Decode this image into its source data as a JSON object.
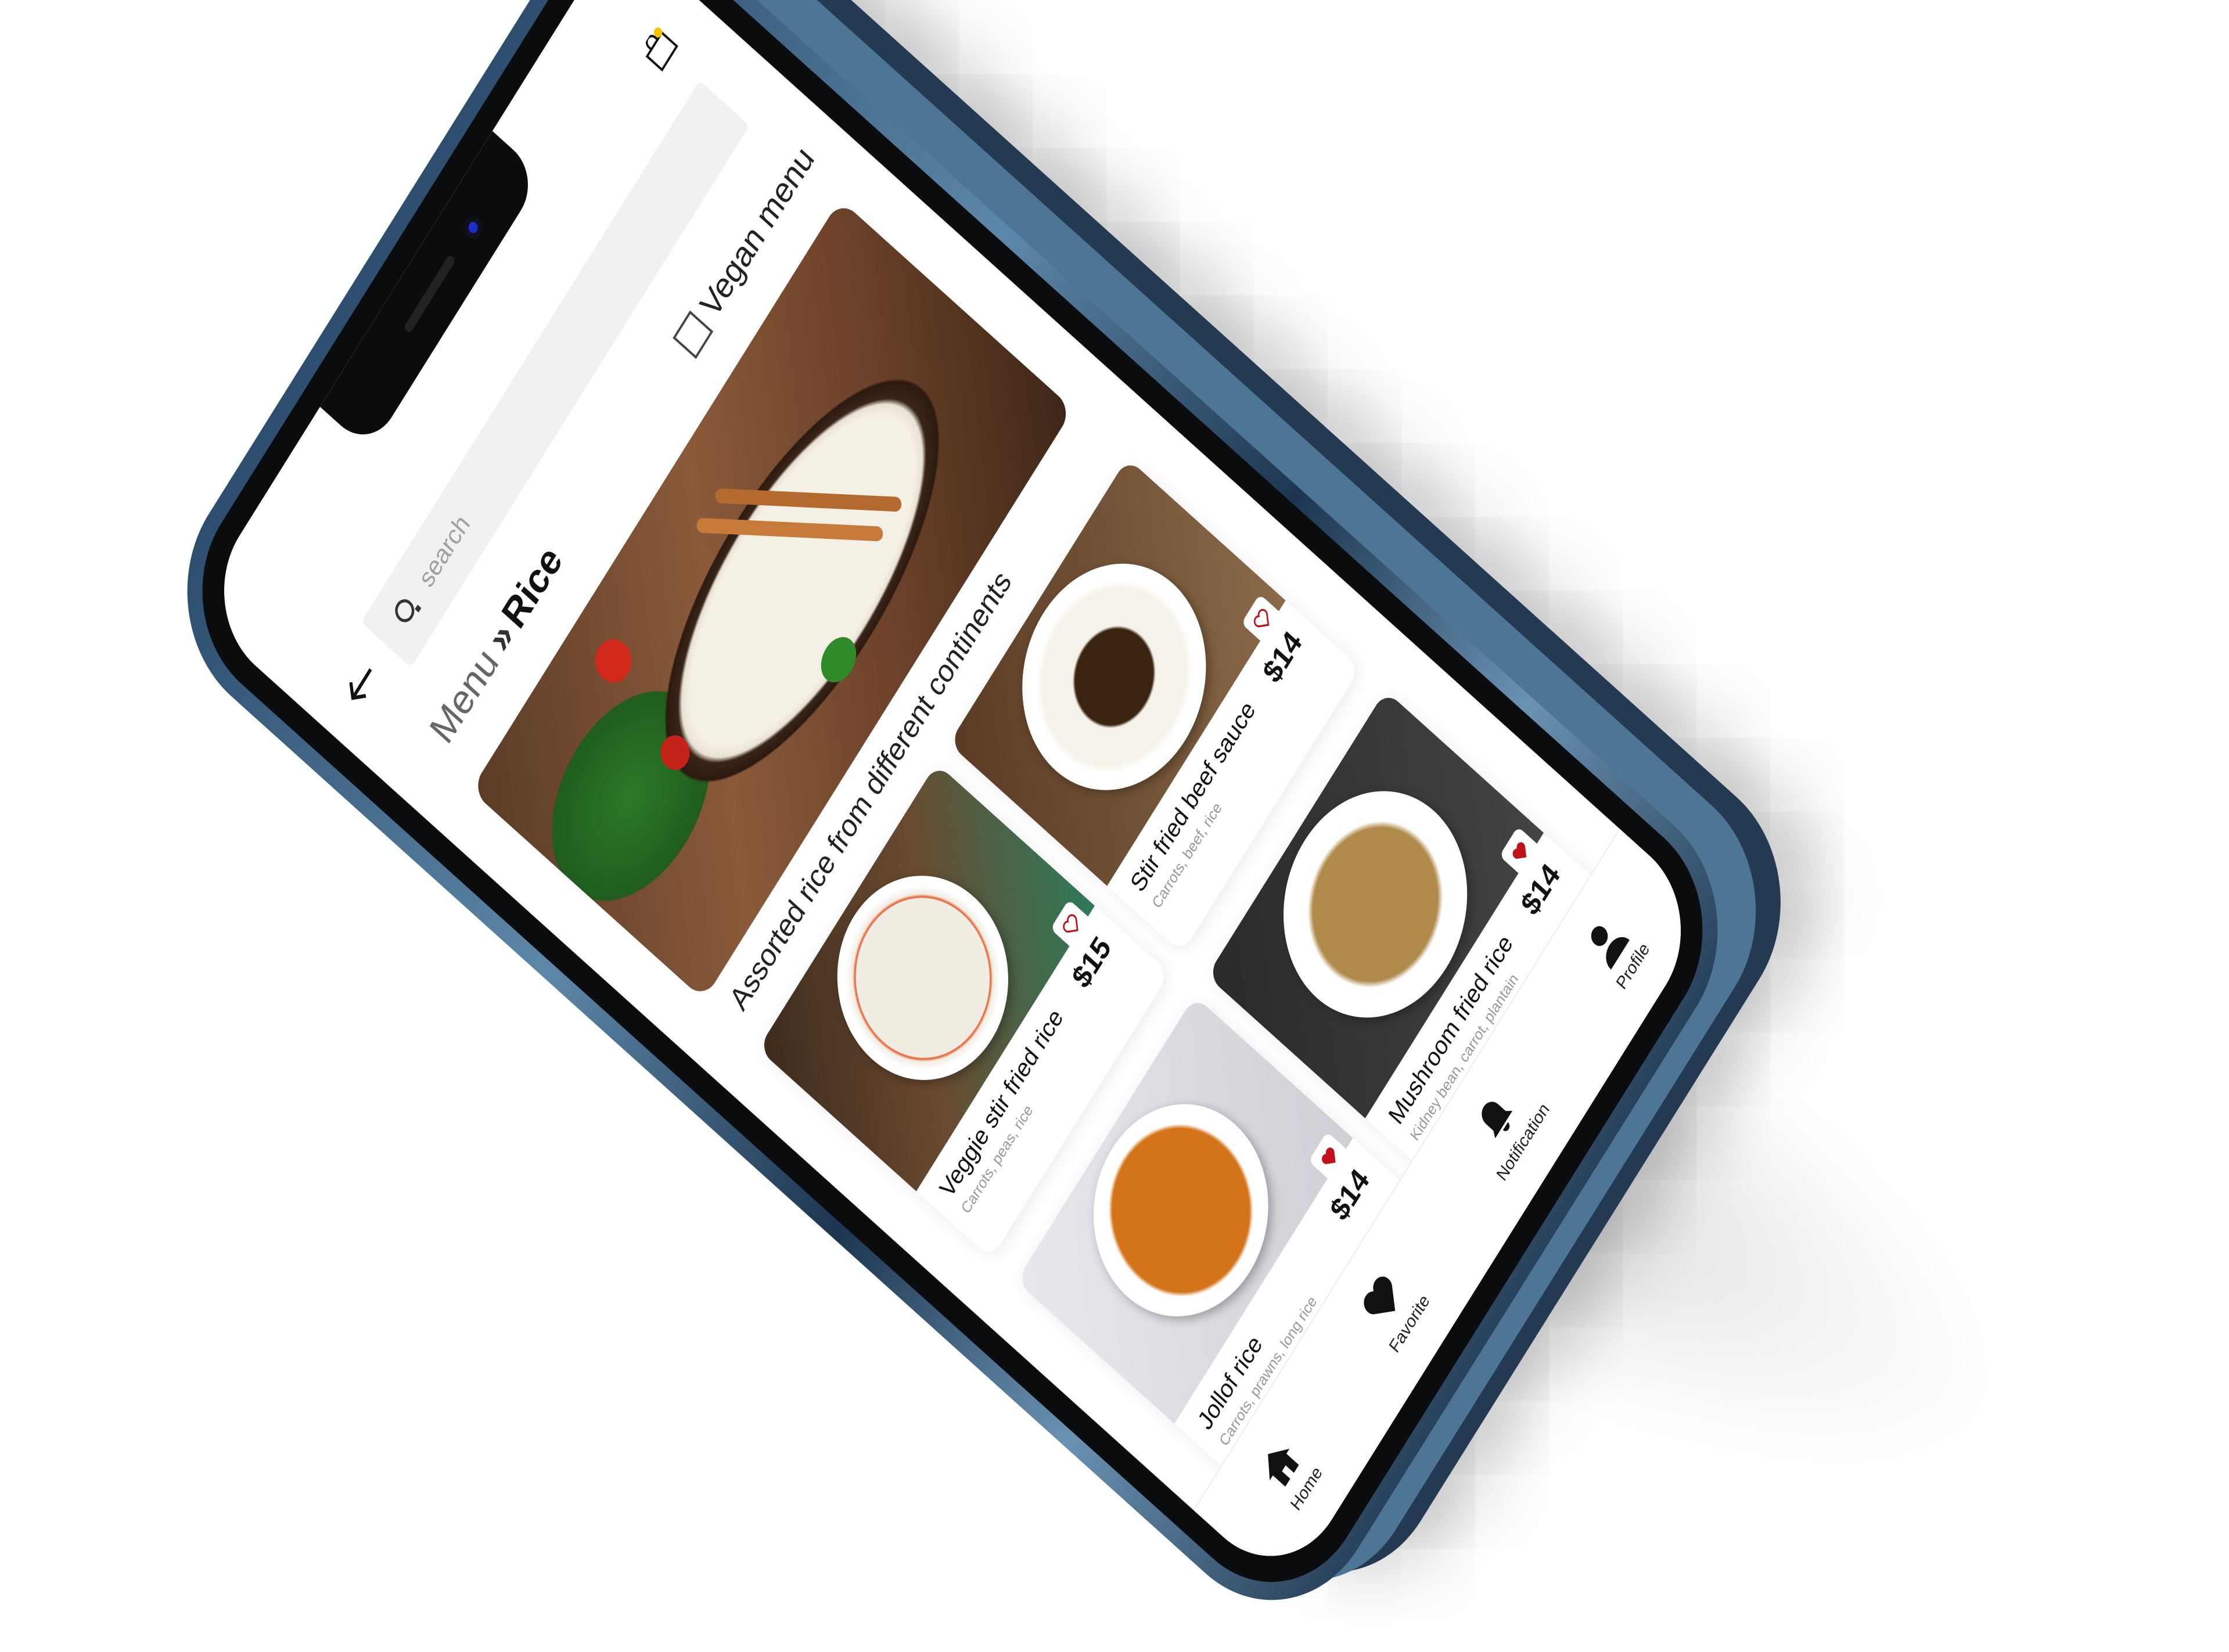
{
  "search": {
    "placeholder": "search"
  },
  "breadcrumb": {
    "parent": "Menu",
    "separator": "»",
    "current": "Rice"
  },
  "filter": {
    "vegan_label": "Vegan menu",
    "vegan_checked": false
  },
  "hero": {
    "caption": "Assorted rice from different continents"
  },
  "items": [
    {
      "name": "Veggie stir fried rice",
      "desc": "Carrots, peas, rice",
      "price": "$15",
      "favorited": false
    },
    {
      "name": "Stir fried beef sauce",
      "desc": "Carrots, beef, rice",
      "price": "$14",
      "favorited": false
    },
    {
      "name": "Jollof rice",
      "desc": "Carrots, prawns, long rice",
      "price": "$14",
      "favorited": true
    },
    {
      "name": "Mushroom fried rice",
      "desc": "Kidney bean, carrot, plantain",
      "price": "$14",
      "favorited": true
    }
  ],
  "nav": [
    {
      "label": "Home",
      "icon": "home-icon"
    },
    {
      "label": "Favorite",
      "icon": "heart-icon"
    },
    {
      "label": "Notification",
      "icon": "bell-icon"
    },
    {
      "label": "Profile",
      "icon": "user-icon"
    }
  ],
  "colors": {
    "accent": "#f5c400",
    "heart_active": "#c0101a",
    "heart_outline": "#c0101a"
  }
}
